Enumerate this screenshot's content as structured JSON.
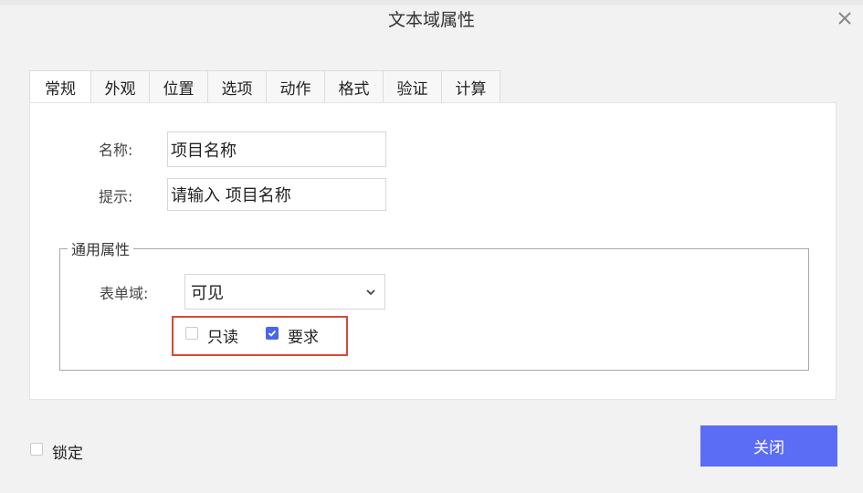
{
  "dialog": {
    "title": "文本域属性"
  },
  "tabs": [
    "常规",
    "外观",
    "位置",
    "选项",
    "动作",
    "格式",
    "验证",
    "计算"
  ],
  "general": {
    "name_label": "名称:",
    "name_value": "项目名称",
    "tip_label": "提示:",
    "tip_value": "请输入 项目名称"
  },
  "common": {
    "legend": "通用属性",
    "form_field_label": "表单域:",
    "form_field_value": "可见",
    "readonly_label": "只读",
    "readonly_checked": false,
    "required_label": "要求",
    "required_checked": true
  },
  "footer": {
    "lock_label": "锁定",
    "lock_checked": false,
    "close_button": "关闭"
  },
  "colors": {
    "accent": "#5b6cf5",
    "highlight": "#d9463b",
    "checkbox_blue": "#4a66e8"
  }
}
